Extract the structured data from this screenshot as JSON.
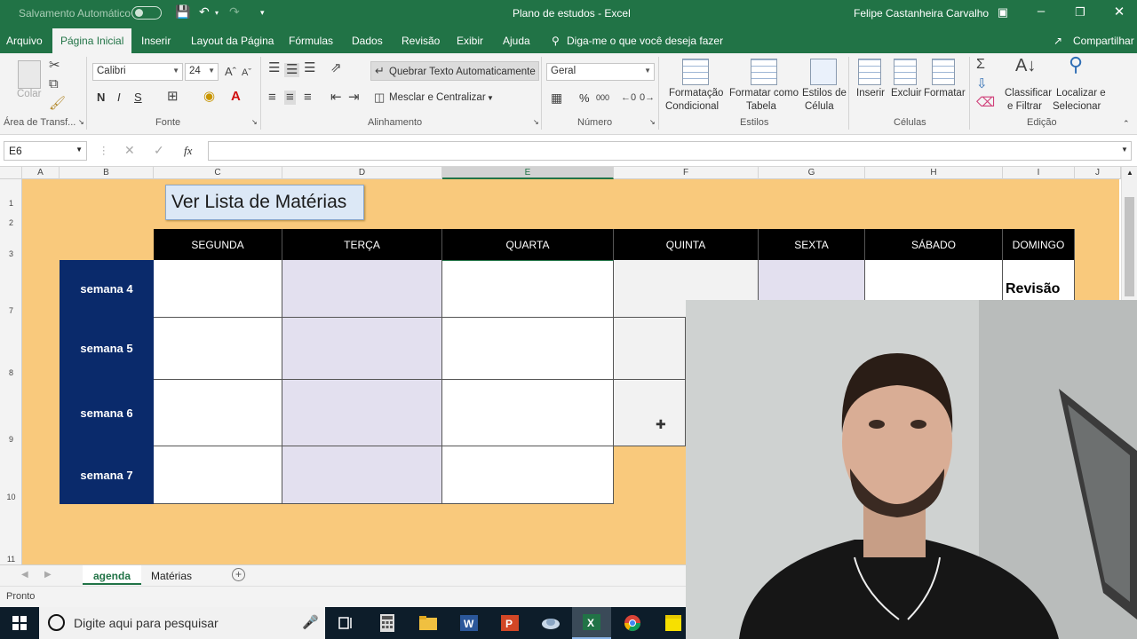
{
  "titlebar": {
    "autosave_label": "Salvamento Automático",
    "title": "Plano de estudos  -  Excel",
    "user": "Felipe Castanheira Carvalho"
  },
  "menu": {
    "tabs": [
      "Arquivo",
      "Página Inicial",
      "Inserir",
      "Layout da Página",
      "Fórmulas",
      "Dados",
      "Revisão",
      "Exibir",
      "Ajuda"
    ],
    "tell_me": "Diga-me o que você deseja fazer",
    "share": "Compartilhar"
  },
  "ribbon": {
    "clipboard": {
      "paste": "Colar",
      "group": "Área de Transf..."
    },
    "font": {
      "name": "Calibri",
      "size": "24",
      "bold": "N",
      "italic": "I",
      "underline": "S",
      "group": "Fonte"
    },
    "alignment": {
      "wrap": "Quebrar Texto Automaticamente",
      "merge": "Mesclar e Centralizar",
      "group": "Alinhamento"
    },
    "number": {
      "format": "Geral",
      "percent": "%",
      "thousands": "000",
      "group": "Número"
    },
    "styles": {
      "conditional": [
        "Formatação",
        "Condicional"
      ],
      "table": [
        "Formatar como",
        "Tabela"
      ],
      "cell_styles": [
        "Estilos de",
        "Célula"
      ],
      "group": "Estilos"
    },
    "cells": {
      "insert": "Inserir",
      "delete": "Excluir",
      "format": "Formatar",
      "group": "Células"
    },
    "editing": {
      "sort": [
        "Classificar",
        "e Filtrar"
      ],
      "find": [
        "Localizar e",
        "Selecionar"
      ],
      "group": "Edição"
    }
  },
  "formula_bar": {
    "name_box": "E6",
    "fx": "fx",
    "content": ""
  },
  "columns": [
    "A",
    "B",
    "C",
    "D",
    "E",
    "F",
    "G",
    "H",
    "I",
    "J"
  ],
  "rows": [
    "1",
    "2",
    "3",
    "7",
    "8",
    "9",
    "10",
    "11"
  ],
  "sheet": {
    "button": "Ver Lista de Matérias",
    "days": [
      "SEGUNDA",
      "TERÇA",
      "QUARTA",
      "QUINTA",
      "SEXTA",
      "SÁBADO",
      "DOMINGO"
    ],
    "weeks": [
      "semana 4",
      "semana 5",
      "semana 6",
      "semana 7"
    ],
    "sunday_label": "Revisão"
  },
  "sheet_tabs": [
    "agenda",
    "Matérias"
  ],
  "status": "Pronto",
  "taskbar": {
    "search_placeholder": "Digite aqui para pesquisar"
  },
  "colors": {
    "excel_green": "#217346",
    "sheet_bg": "#f9c97c",
    "week_blue": "#0a2a6b",
    "lavender": "#e3e0ef"
  }
}
